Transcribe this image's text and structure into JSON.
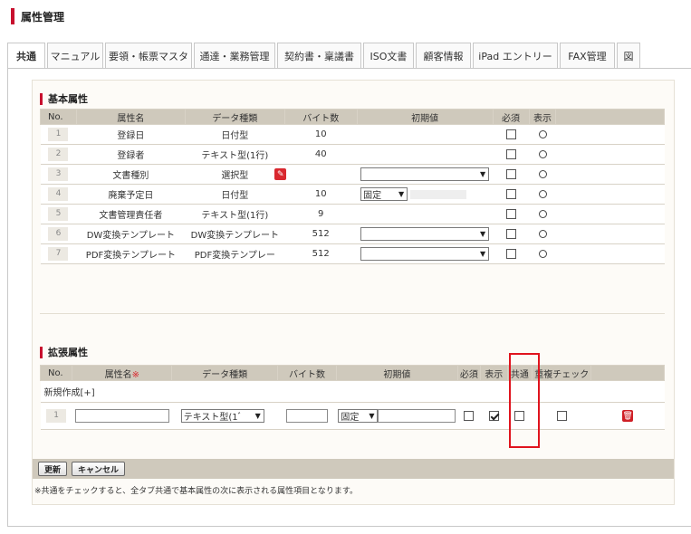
{
  "header": {
    "title": "属性管理"
  },
  "tabs": [
    {
      "label": "共通",
      "active": true
    },
    {
      "label": "マニュアル"
    },
    {
      "label": "要領・帳票マスタ"
    },
    {
      "label": "通達・業務管理"
    },
    {
      "label": "契約書・稟議書"
    },
    {
      "label": "ISO文書"
    },
    {
      "label": "顧客情報"
    },
    {
      "label": "iPad エントリー"
    },
    {
      "label": "FAX管理"
    },
    {
      "label": "図"
    }
  ],
  "basic": {
    "section_title": "基本属性",
    "columns": [
      "No.",
      "属性名",
      "データ種類",
      "バイト数",
      "初期値",
      "必須",
      "表示"
    ],
    "rows": [
      {
        "no": "1",
        "name": "登録日",
        "type": "日付型",
        "bytes": "10",
        "initial": "",
        "required": false,
        "display": "○"
      },
      {
        "no": "2",
        "name": "登録者",
        "type": "テキスト型(1行)",
        "bytes": "40",
        "initial": "",
        "required": false,
        "display": "○"
      },
      {
        "no": "3",
        "name": "文書種別",
        "type": "選択型",
        "bytes": "",
        "initial": "select",
        "required": false,
        "display": "○"
      },
      {
        "no": "4",
        "name": "廃棄予定日",
        "type": "日付型",
        "bytes": "10",
        "initial": "固定",
        "required": false,
        "display": "○"
      },
      {
        "no": "5",
        "name": "文書管理責任者",
        "type": "テキスト型(1行)",
        "bytes": "9",
        "initial": "",
        "required": false,
        "display": "○"
      },
      {
        "no": "6",
        "name": "DW変換テンプレート",
        "type": "DW変換テンプレート",
        "bytes": "512",
        "initial": "select",
        "required": false,
        "display": "○"
      },
      {
        "no": "7",
        "name": "PDF変換テンプレート",
        "type": "PDF変換テンプレー",
        "bytes": "512",
        "initial": "select",
        "required": false,
        "display": "○"
      }
    ]
  },
  "extended": {
    "section_title": "拡張属性",
    "columns": [
      "No.",
      "属性名",
      "データ種類",
      "バイト数",
      "初期値",
      "必須",
      "表示",
      "共通",
      "重複チェック"
    ],
    "required_mark": "※",
    "new_label": "新規作成[+]",
    "row": {
      "no": "1",
      "type": "テキスト型(1ﾞ",
      "initial": "固定",
      "required": false,
      "display": true,
      "common": false,
      "duplicate": false
    }
  },
  "buttons": {
    "update": "更新",
    "cancel": "キャンセル"
  },
  "note": "※共通をチェックすると、全タブ共通で基本属性の次に表示される属性項目となります。",
  "colors": {
    "accent": "#c8102e",
    "header_bg": "#cfc9bc",
    "highlight": "#e0141e"
  }
}
